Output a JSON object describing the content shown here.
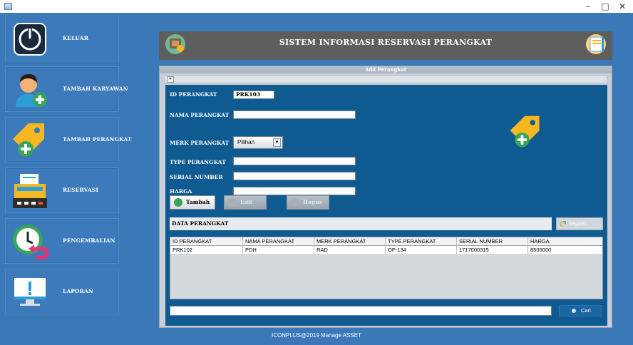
{
  "window": {
    "minimize_glyph": "–",
    "maximize_glyph": "□",
    "close_glyph": "✕"
  },
  "sidebar": {
    "items": [
      {
        "label": "KELUAR",
        "icon": "power-icon"
      },
      {
        "label": "TAMBAH KARYAWAN",
        "icon": "add-user-icon"
      },
      {
        "label": "TAMBAH PERANGKAT",
        "icon": "add-tag-icon"
      },
      {
        "label": "RESERVASI",
        "icon": "cash-register-icon"
      },
      {
        "label": "PENGEMBALIAN",
        "icon": "clock-return-icon"
      },
      {
        "label": "LAPORAN",
        "icon": "monitor-alert-icon"
      }
    ]
  },
  "header": {
    "title": "SISTEM INFORMASI RESERVASI PERANGKAT"
  },
  "internal_frame": {
    "title": "Add Perangkat"
  },
  "form": {
    "id_label": "ID PERANGKAT",
    "id_value": "PRK103",
    "nama_label": "NAMA PERANGKAT",
    "nama_value": "",
    "merk_label": "MERK PERANGKAT",
    "merk_selected": "Pilihan",
    "type_label": "TYPE PERANGKAT",
    "type_value": "",
    "serial_label": "SERIAL NUMBER",
    "serial_value": "",
    "harga_label": "HARGA",
    "harga_value": ""
  },
  "buttons": {
    "tambah": "Tambah",
    "edit": "Edit",
    "hapus": "Hapus",
    "refresh": "Segark...",
    "search": "Cari"
  },
  "data_section": {
    "title": "DATA PERANGKAT"
  },
  "table": {
    "columns": [
      "ID PERANGKAT",
      "NAMA PERANGKAT",
      "MERK PERANGKAT",
      "TYPE PERANGKAT",
      "SERIAL NUMBER",
      "HARGA"
    ],
    "rows": [
      [
        "PRK102",
        "PDH",
        "RAD",
        "OP-134",
        "1717000315",
        "8500000"
      ]
    ]
  },
  "search": {
    "value": ""
  },
  "footer": {
    "text": "ICONPLUS@2019 Manage ASSET"
  },
  "colors": {
    "background": "#3a78b8",
    "content_panel": "#0f5a91",
    "header": "#5e5e5e",
    "accent_green": "#3aa55a",
    "tag_yellow": "#f5b820"
  }
}
